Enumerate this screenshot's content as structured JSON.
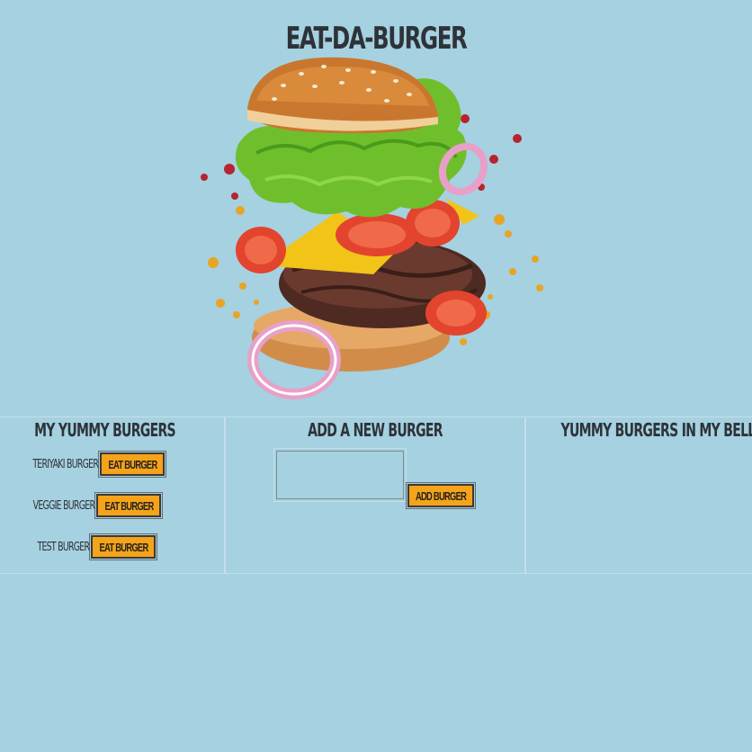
{
  "header": {
    "title": "EAT-DA-BURGER",
    "hero_image": "flying-burger-image"
  },
  "my_burgers": {
    "heading": "MY YUMMY BURGERS",
    "items": [
      {
        "name": "TERIYAKI BURGER",
        "button_label": "EAT BURGER"
      },
      {
        "name": "VEGGIE BURGER",
        "button_label": "EAT BURGER"
      },
      {
        "name": "TEST BURGER",
        "button_label": "EAT BURGER"
      }
    ]
  },
  "add_burger": {
    "heading": "ADD A NEW BURGER",
    "input_value": "",
    "button_label": "ADD BURGER"
  },
  "belly": {
    "heading": "YUMMY BURGERS IN MY BELLY",
    "items": []
  },
  "colors": {
    "background": "#a5d1e1",
    "button": "#f5a318",
    "text": "#2e3338"
  }
}
